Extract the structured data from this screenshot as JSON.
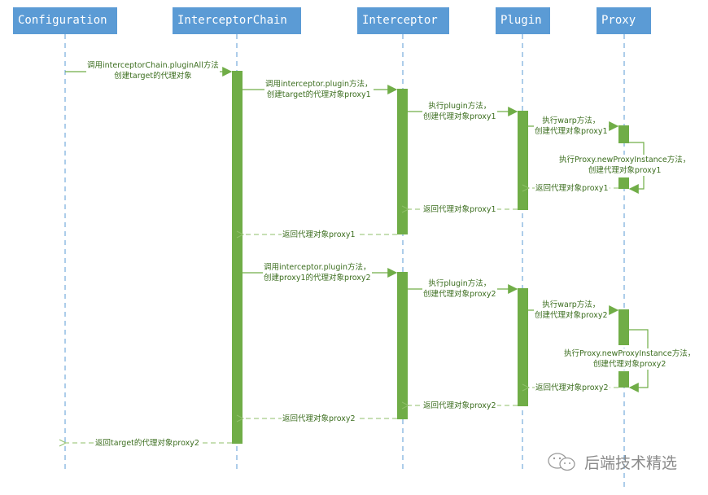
{
  "actors": [
    "Configuration",
    "InterceptorChain",
    "Interceptor",
    "Plugin",
    "Proxy"
  ],
  "messages": {
    "m1": [
      "调用interceptorChain.pluginAll方法",
      "创建target的代理对象"
    ],
    "m2": [
      "调用interceptor.plugin方法，",
      "创建target的代理对象proxy1"
    ],
    "m3": [
      "执行plugin方法，",
      "创建代理对象proxy1"
    ],
    "m4": [
      "执行warp方法，",
      "创建代理对象proxy1"
    ],
    "m5": [
      "执行Proxy.newProxyInstance方法，",
      "创建代理对象proxy1"
    ],
    "r1": "返回代理对象proxy1",
    "r2": "返回代理对象proxy1",
    "r3": "返回代理对象proxy1",
    "m6": [
      "调用interceptor.plugin方法，",
      "创建proxy1的代理对象proxy2"
    ],
    "m7": [
      "执行plugin方法，",
      "创建代理对象proxy2"
    ],
    "m8": [
      "执行warp方法，",
      "创建代理对象proxy2"
    ],
    "m9": [
      "执行Proxy.newProxyInstance方法，",
      "创建代理对象proxy2"
    ],
    "r4": "返回代理对象proxy2",
    "r5": "返回代理对象proxy2",
    "r6": "返回代理对象proxy2",
    "r7": "返回target的代理对象proxy2"
  },
  "watermark": {
    "icon": "wechat-icon",
    "text": "后端技术精选"
  },
  "colors": {
    "actor": "#5b9bd5",
    "activation": "#70ad47",
    "lifeline": "#5b9bd5",
    "message": "#70ad47"
  }
}
